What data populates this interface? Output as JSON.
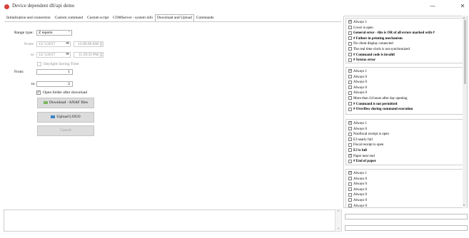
{
  "window": {
    "title": "Device dependent dll/api demo",
    "minimize": "—",
    "close": "✕"
  },
  "tabs": [
    {
      "label": "Initialization and connection"
    },
    {
      "label": "Custom command"
    },
    {
      "label": "Custom script"
    },
    {
      "label": "COMServer - system info"
    },
    {
      "label": "Download and Upload"
    },
    {
      "label": "Commands"
    }
  ],
  "form": {
    "range_type_label": "Range type:",
    "range_type_value": "Z reports",
    "from_label": "From:",
    "from_date": "12/ 5/2017",
    "from_time": "12:00:00 AM",
    "to_label": "to:",
    "to_date": "12/ 5/2017",
    "to_time": "11:59:59 PM",
    "dst_label": "Daylight Saving Time",
    "num_from_label": "From:",
    "num_from_value": "1",
    "num_to_label": "to:",
    "num_to_value": "2",
    "open_folder_label": "Open folder after download",
    "download_btn": "Download - ANAF files",
    "upload_btn": "Upload LOGO",
    "cancel_btn": "Cancel"
  },
  "status_groups": [
    {
      "items": [
        {
          "text": "Always 1",
          "checked": true,
          "bold": false
        },
        {
          "text": "Cover is open",
          "checked": false,
          "bold": false
        },
        {
          "text": "General error - this is OR of all errors marked with #",
          "checked": false,
          "bold": true
        },
        {
          "text": "# Failure in printing mechanism",
          "checked": false,
          "bold": true
        },
        {
          "text": "No client display connected",
          "checked": false,
          "bold": false
        },
        {
          "text": "The real time clock is not synchronized",
          "checked": false,
          "bold": false
        },
        {
          "text": "# Command code is invalid",
          "checked": false,
          "bold": true
        },
        {
          "text": "# Syntax error",
          "checked": false,
          "bold": true
        }
      ]
    },
    {
      "items": [
        {
          "text": "Always 1",
          "checked": true,
          "bold": false
        },
        {
          "text": "Always 0",
          "checked": false,
          "bold": false
        },
        {
          "text": "Always 0",
          "checked": false,
          "bold": false
        },
        {
          "text": "Always 0",
          "checked": false,
          "bold": false
        },
        {
          "text": "Always 0",
          "checked": false,
          "bold": false
        },
        {
          "text": "More than 24 hours after day opening",
          "checked": false,
          "bold": false
        },
        {
          "text": "# Command is not permitted",
          "checked": false,
          "bold": true
        },
        {
          "text": "# Overflow during command execution",
          "checked": false,
          "bold": true
        }
      ]
    },
    {
      "items": [
        {
          "text": "Always 1",
          "checked": true,
          "bold": false
        },
        {
          "text": "Always 0",
          "checked": false,
          "bold": false
        },
        {
          "text": "Nonfiscal receipt is open",
          "checked": false,
          "bold": false
        },
        {
          "text": "EJ nearly full",
          "checked": false,
          "bold": false
        },
        {
          "text": "Fiscal receipt is open",
          "checked": false,
          "bold": false
        },
        {
          "text": "EJ is full",
          "checked": false,
          "bold": true
        },
        {
          "text": "Paper near end",
          "checked": true,
          "bold": false
        },
        {
          "text": "# End of paper",
          "checked": false,
          "bold": true
        }
      ]
    },
    {
      "items": [
        {
          "text": "Always 1",
          "checked": true,
          "bold": false
        },
        {
          "text": "Always 0",
          "checked": false,
          "bold": false
        },
        {
          "text": "Always 0",
          "checked": false,
          "bold": false
        },
        {
          "text": "Always 0",
          "checked": false,
          "bold": false
        },
        {
          "text": "Always 0",
          "checked": false,
          "bold": false
        },
        {
          "text": "Always 0",
          "checked": false,
          "bold": false
        },
        {
          "text": "Always 0",
          "checked": false,
          "bold": false
        }
      ]
    }
  ],
  "icons": {
    "app": "app-logo-icon",
    "download": "download-icon",
    "upload": "upload-icon"
  },
  "colors": {
    "app_icon": "#d6423a",
    "button": "#dcdcdc"
  }
}
